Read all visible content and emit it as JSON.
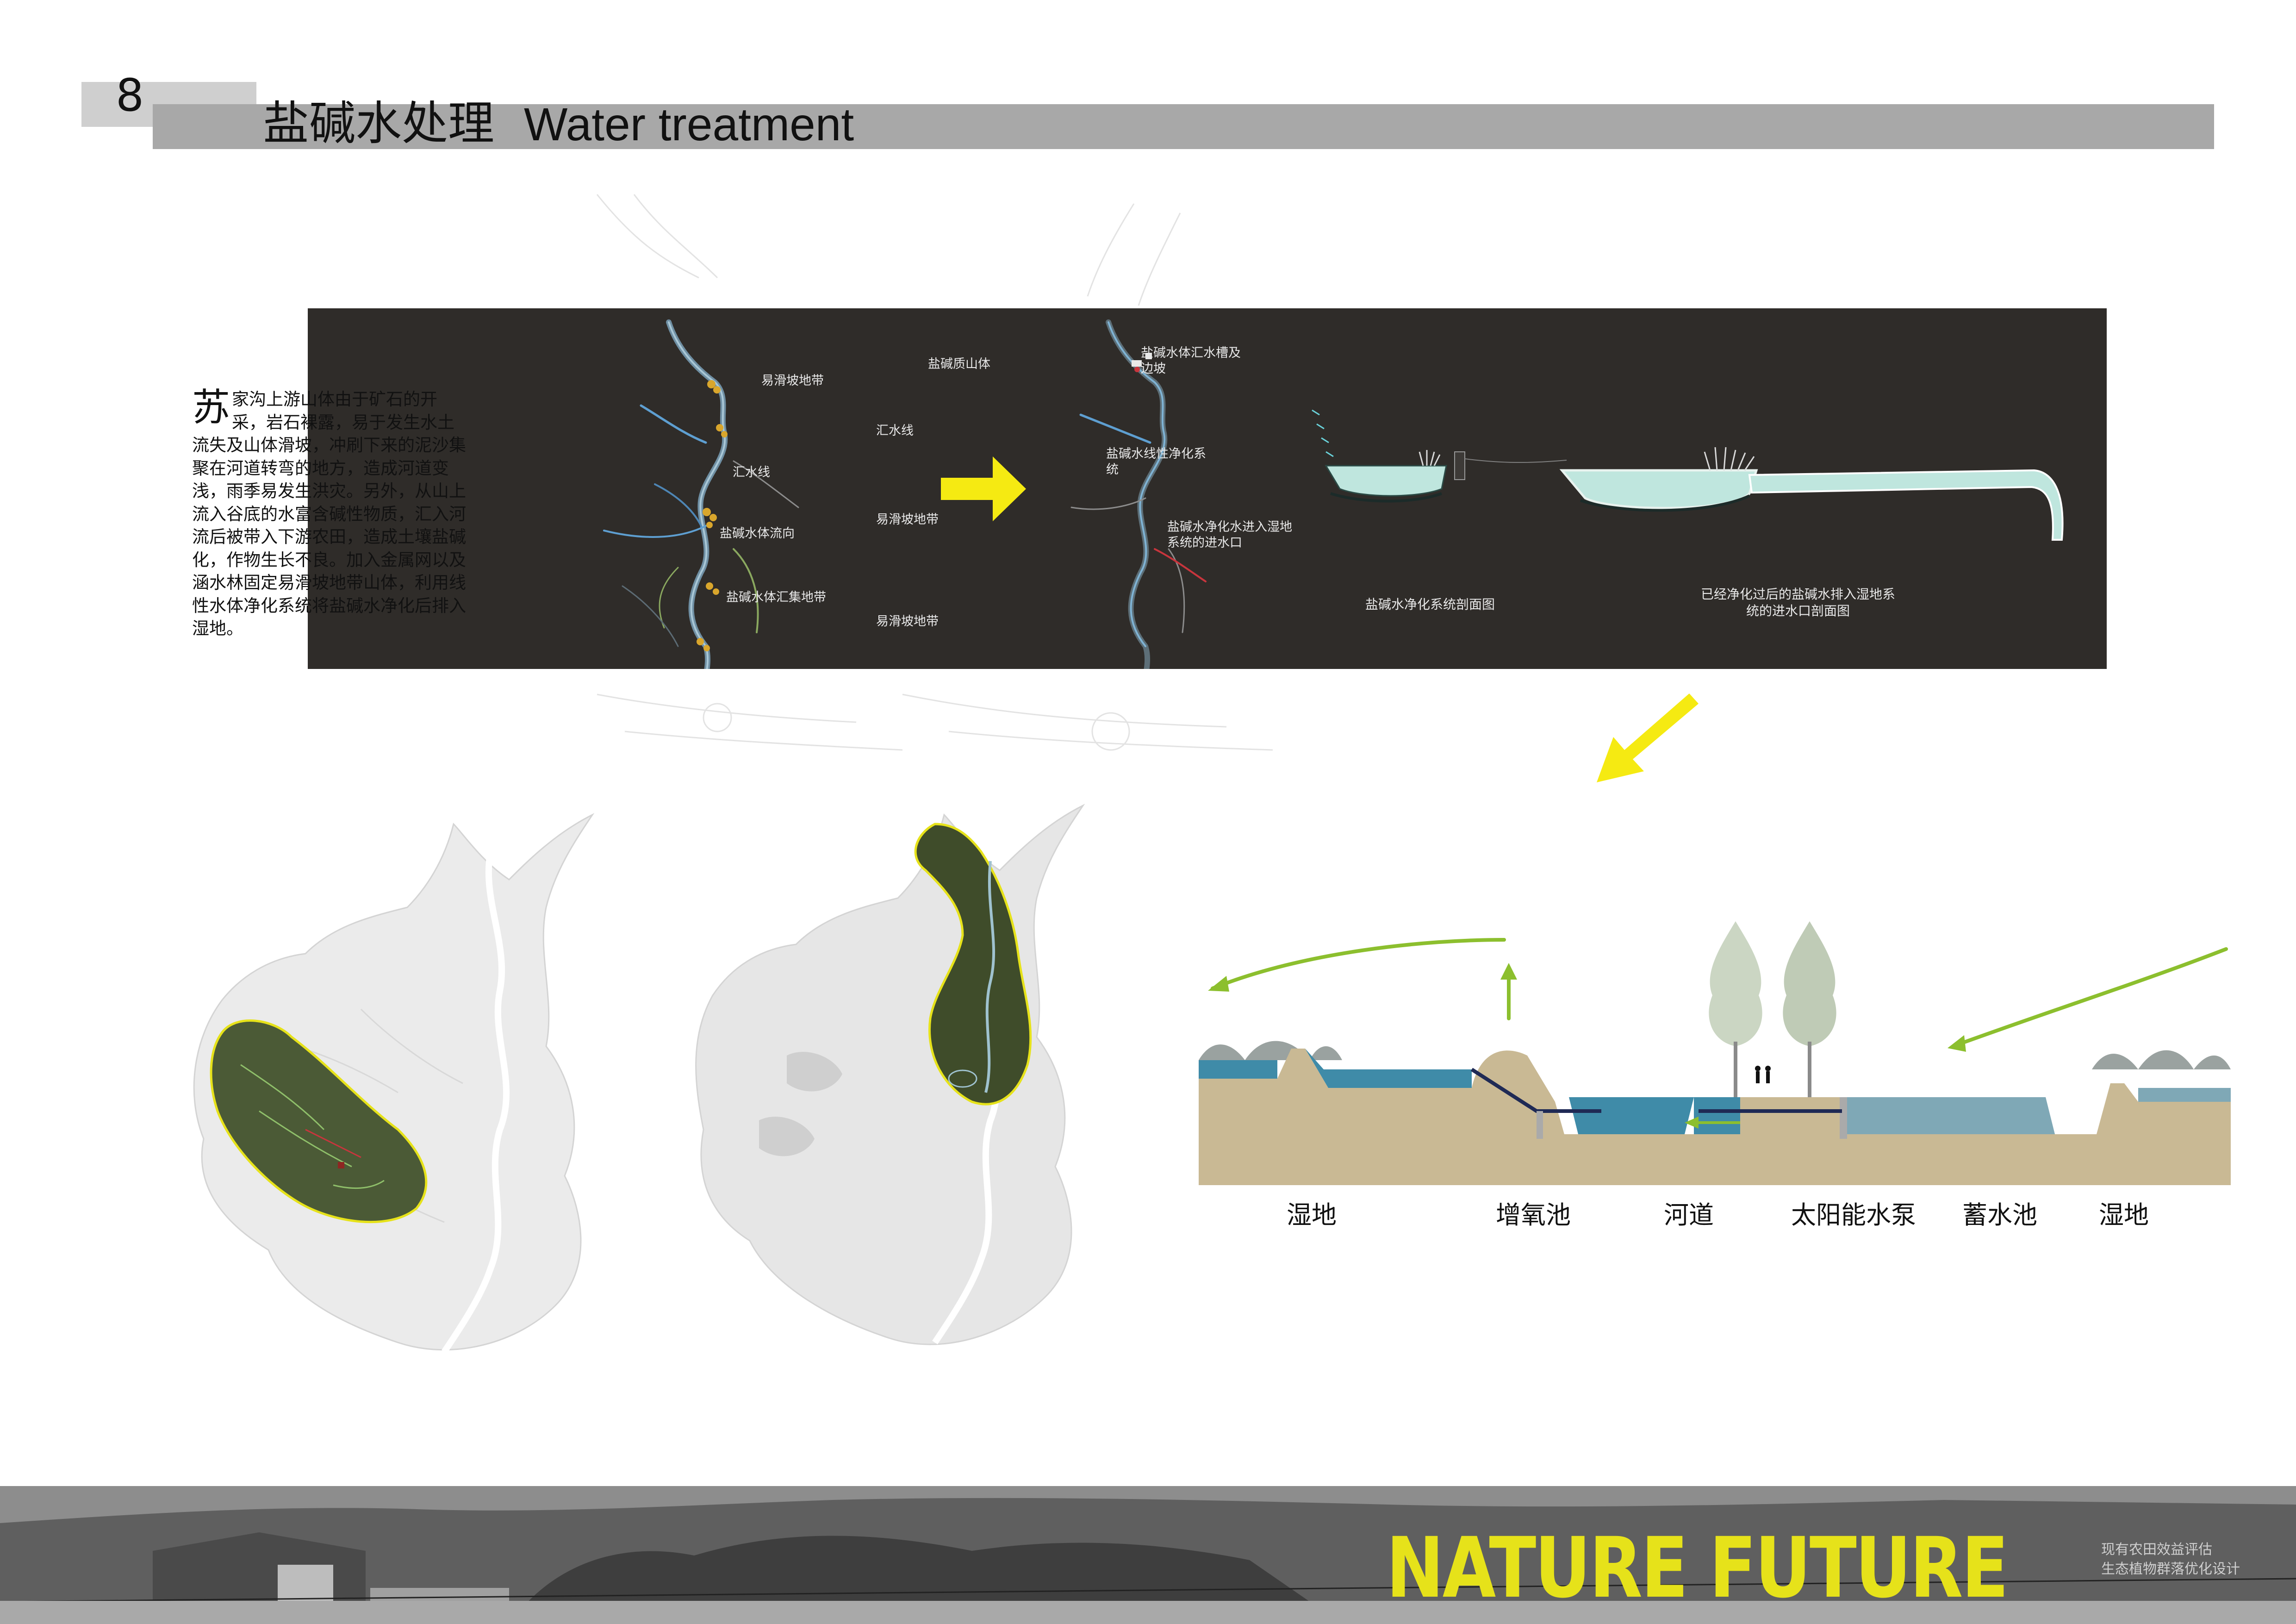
{
  "header": {
    "page_number": "8",
    "title_cn": "盐碱水处理",
    "title_en": "Water treatment"
  },
  "intro": {
    "dropcap": "苏",
    "text": "家沟上游山体由于矿石的开采，岩石裸露，易于发生水土流失及山体滑坡，冲刷下来的泥沙集聚在河道转弯的地方，造成河道变浅，雨季易发生洪灾。另外，从山上流入谷底的水富含碱性物质，汇入河流后被带入下游农田，造成土壤盐碱化，作物生长不良。加入金属网以及涵水林固定易滑坡地带山体，利用线性水体净化系统将盐碱水净化后排入湿地。"
  },
  "map_left": {
    "labels": [
      "易滑坡地带",
      "盐碱质山体",
      "汇水线",
      "汇水线",
      "盐碱水体流向",
      "易滑坡地带",
      "盐碱水体汇集地带",
      "易滑坡地带"
    ]
  },
  "map_right": {
    "labels": [
      "盐碱水体汇水槽及边坡",
      "盐碱水线性净化系统",
      "盐碱水净化水进入湿地系统的进水口"
    ]
  },
  "captions": {
    "section1": "盐碱水净化系统剖面图",
    "section2": "已经净化过后的盐碱水排入湿地系统的进水口剖面图"
  },
  "section_labels": [
    "湿地",
    "增氧池",
    "河道",
    "太阳能水泵",
    "蓄水池",
    "湿地"
  ],
  "footer": {
    "brand": "NATURE FUTURE",
    "subtitle_1": "现有农田效益评估",
    "subtitle_2": "生态植物群落优化设计"
  },
  "colors": {
    "dark_panel": "#2f2c29",
    "arrow_yellow": "#f5ea12",
    "water_blue": "#3f8ba8",
    "earth": "#c8b792",
    "arrow_green": "#8cbf2e",
    "brand_yellow": "#e6e21a"
  }
}
